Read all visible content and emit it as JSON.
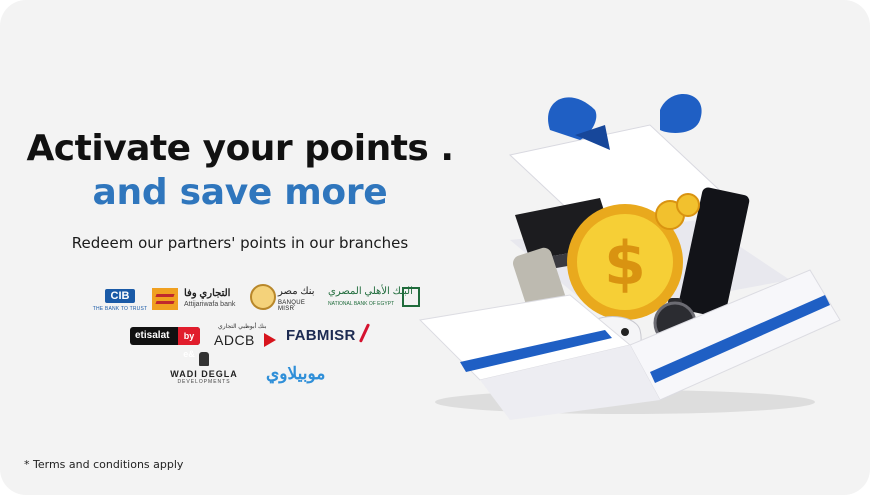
{
  "headline": {
    "line1": "Activate your points .",
    "line2": "and save more"
  },
  "subtitle": "Redeem our partners' points in our branches",
  "terms": "* Terms and conditions apply",
  "partners": {
    "cib": {
      "mark": "CIB",
      "tagline": "THE BANK TO TRUST"
    },
    "attijariwafa": {
      "arabic": "التجاري وفا",
      "name": "Attijariwafa bank"
    },
    "banque_misr": {
      "arabic": "بنك مصر",
      "name": "BANQUE MISR"
    },
    "nbe": {
      "arabic": "البنك الأهلي المصري",
      "name": "NATIONAL BANK OF EGYPT"
    },
    "etisalat": {
      "name": "etisalat",
      "badge": "by e&"
    },
    "adcb": {
      "arabic": "بنك أبوظبي التجاري",
      "name": "ADCB"
    },
    "fab": {
      "name": "FABMISR"
    },
    "wadi_degla": {
      "name": "WADI DEGLA",
      "sub": "DEVELOPMENTS"
    },
    "mobilaty": {
      "name": "موبيلاوي"
    }
  },
  "colors": {
    "headline_dark": "#111111",
    "headline_blue": "#2f76bd",
    "ribbon_blue": "#1f5fc4",
    "coin_gold": "#f2c12e",
    "background": "#f3f3f3"
  },
  "illustration": {
    "icons": [
      "gift-box-icon",
      "ribbon-icon",
      "gold-coin-icon",
      "laptop-icon",
      "smartphone-icon",
      "smartwatch-icon",
      "game-controller-icon",
      "tablet-icon"
    ]
  }
}
